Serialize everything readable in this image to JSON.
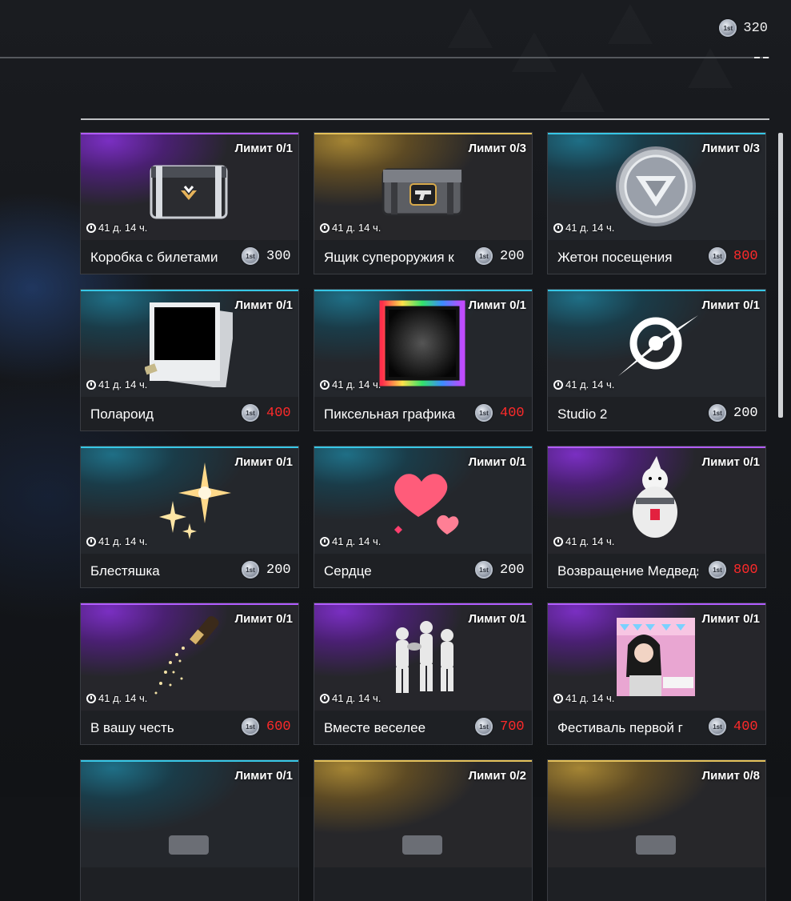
{
  "currency": {
    "icon": "1st-coin-icon",
    "coin_text": "1st",
    "value": "320"
  },
  "items": [
    {
      "limit": "Лимит 0/1",
      "timer": "41 д. 14 ч.",
      "name": "Коробка с билетами",
      "price": "300",
      "price_color": "#ffffff",
      "theme": "purple",
      "icon": "ticket-box-icon"
    },
    {
      "limit": "Лимит 0/3",
      "timer": "41 д. 14 ч.",
      "name": "Ящик супероружия к",
      "price": "200",
      "price_color": "#ffffff",
      "theme": "gold",
      "icon": "weapon-crate-icon"
    },
    {
      "limit": "Лимит 0/3",
      "timer": "41 д. 14 ч.",
      "name": "Жетон посещения",
      "price": "800",
      "price_color": "#ff2a2a",
      "theme": "teal",
      "icon": "token-icon"
    },
    {
      "limit": "Лимит 0/1",
      "timer": "41 д. 14 ч.",
      "name": "Полароид",
      "price": "400",
      "price_color": "#ff2a2a",
      "theme": "teal",
      "icon": "polaroid-icon"
    },
    {
      "limit": "Лимит 0/1",
      "timer": "41 д. 14 ч.",
      "name": "Пиксельная графика",
      "price": "400",
      "price_color": "#ff2a2a",
      "theme": "teal",
      "icon": "pixel-frame-icon"
    },
    {
      "limit": "Лимит 0/1",
      "timer": "41 д. 14 ч.",
      "name": "Studio 2",
      "price": "200",
      "price_color": "#ffffff",
      "theme": "teal",
      "icon": "studio-logo-icon"
    },
    {
      "limit": "Лимит 0/1",
      "timer": "41 д. 14 ч.",
      "name": "Блестяшка",
      "price": "200",
      "price_color": "#ffffff",
      "theme": "teal",
      "icon": "sparkle-icon"
    },
    {
      "limit": "Лимит 0/1",
      "timer": "41 д. 14 ч.",
      "name": "Сердце",
      "price": "200",
      "price_color": "#ffffff",
      "theme": "teal",
      "icon": "heart-icon"
    },
    {
      "limit": "Лимит 0/1",
      "timer": "41 д. 14 ч.",
      "name": "Возвращение Медведя",
      "price": "800",
      "price_color": "#ff2a2a",
      "theme": "purple",
      "icon": "bear-icon"
    },
    {
      "limit": "Лимит 0/1",
      "timer": "41 д. 14 ч.",
      "name": "В вашу честь",
      "price": "600",
      "price_color": "#ff2a2a",
      "theme": "purple",
      "icon": "champagne-icon"
    },
    {
      "limit": "Лимит 0/1",
      "timer": "41 д. 14 ч.",
      "name": "Вместе веселее",
      "price": "700",
      "price_color": "#ff2a2a",
      "theme": "purple",
      "icon": "group-dance-icon"
    },
    {
      "limit": "Лимит 0/1",
      "timer": "41 д. 14 ч.",
      "name": "Фестиваль первой г",
      "price": "400",
      "price_color": "#ff2a2a",
      "theme": "purple",
      "icon": "festival-portrait-icon"
    },
    {
      "limit": "Лимит 0/1",
      "timer": "",
      "name": "",
      "price": "",
      "price_color": "#ffffff",
      "theme": "teal",
      "icon": "item-icon"
    },
    {
      "limit": "Лимит 0/2",
      "timer": "",
      "name": "",
      "price": "",
      "price_color": "#ffffff",
      "theme": "gold",
      "icon": "item-icon"
    },
    {
      "limit": "Лимит 0/8",
      "timer": "",
      "name": "",
      "price": "",
      "price_color": "#ffffff",
      "theme": "gold",
      "icon": "item-icon"
    }
  ]
}
